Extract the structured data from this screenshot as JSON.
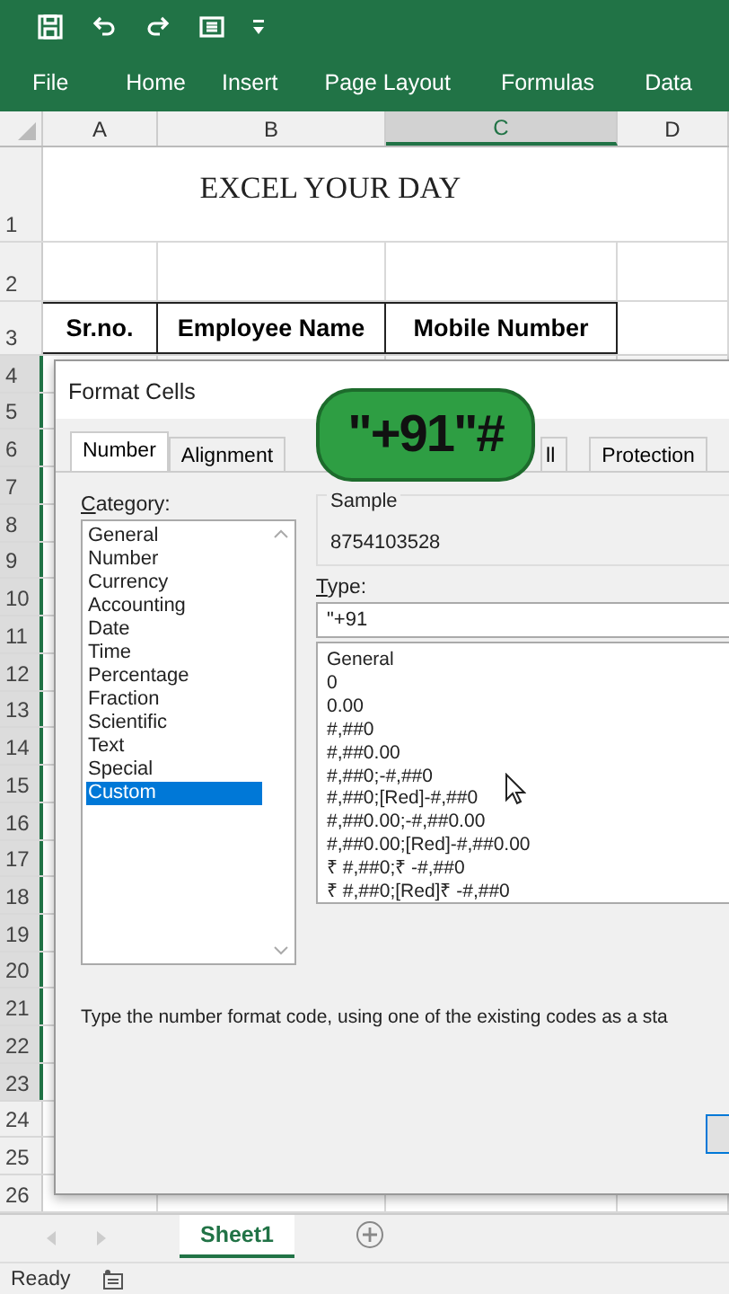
{
  "ribbon": {
    "tabs": [
      "File",
      "Home",
      "Insert",
      "Page Layout",
      "Formulas",
      "Data"
    ]
  },
  "sheet": {
    "columns": [
      {
        "label": "A",
        "selected": false
      },
      {
        "label": "B",
        "selected": false
      },
      {
        "label": "C",
        "selected": true
      },
      {
        "label": "D",
        "selected": false
      }
    ],
    "title": "EXCEL YOUR DAY",
    "header_row": [
      "Sr.no.",
      "Employee Name",
      "Mobile Number"
    ],
    "rows": [
      {
        "label": "1",
        "selected": false
      },
      {
        "label": "2",
        "selected": false
      },
      {
        "label": "3",
        "selected": false
      },
      {
        "label": "4",
        "selected": true
      },
      {
        "label": "5",
        "selected": true
      },
      {
        "label": "6",
        "selected": true
      },
      {
        "label": "7",
        "selected": true
      },
      {
        "label": "8",
        "selected": true
      },
      {
        "label": "9",
        "selected": true
      },
      {
        "label": "10",
        "selected": true
      },
      {
        "label": "11",
        "selected": true
      },
      {
        "label": "12",
        "selected": true
      },
      {
        "label": "13",
        "selected": true
      },
      {
        "label": "14",
        "selected": true
      },
      {
        "label": "15",
        "selected": true
      },
      {
        "label": "16",
        "selected": true
      },
      {
        "label": "17",
        "selected": true
      },
      {
        "label": "18",
        "selected": true
      },
      {
        "label": "19",
        "selected": true
      },
      {
        "label": "20",
        "selected": true
      },
      {
        "label": "21",
        "selected": true
      },
      {
        "label": "22",
        "selected": true
      },
      {
        "label": "23",
        "selected": true
      },
      {
        "label": "24",
        "selected": false
      },
      {
        "label": "25",
        "selected": false
      },
      {
        "label": "26",
        "selected": false
      }
    ]
  },
  "dialog": {
    "title": "Format Cells",
    "tabs": [
      {
        "label": "Number",
        "selected": true
      },
      {
        "label": "Alignment",
        "selected": false
      },
      {
        "label": "ll",
        "selected": false
      },
      {
        "label": "Protection",
        "selected": false
      }
    ],
    "category_label": "Category:",
    "categories": [
      {
        "label": "General",
        "selected": false
      },
      {
        "label": "Number",
        "selected": false
      },
      {
        "label": "Currency",
        "selected": false
      },
      {
        "label": "Accounting",
        "selected": false
      },
      {
        "label": "Date",
        "selected": false
      },
      {
        "label": "Time",
        "selected": false
      },
      {
        "label": "Percentage",
        "selected": false
      },
      {
        "label": "Fraction",
        "selected": false
      },
      {
        "label": "Scientific",
        "selected": false
      },
      {
        "label": "Text",
        "selected": false
      },
      {
        "label": "Special",
        "selected": false
      },
      {
        "label": "Custom",
        "selected": true
      }
    ],
    "sample_label": "Sample",
    "sample_value": "8754103528",
    "type_label": "Type:",
    "type_value": "\"+91",
    "formats": [
      "General",
      "0",
      "0.00",
      "#,##0",
      "#,##0.00",
      "#,##0;-#,##0",
      "#,##0;[Red]-#,##0",
      "#,##0.00;-#,##0.00",
      "#,##0.00;[Red]-#,##0.00",
      "₹ #,##0;₹ -#,##0",
      "₹ #,##0;[Red]₹ -#,##0"
    ],
    "description": "Type the number format code, using one of the existing codes as a sta"
  },
  "badge": {
    "text": "\"+91\"#"
  },
  "sheet_tabs": [
    {
      "label": "Sheet1",
      "selected": true
    }
  ],
  "status_bar": {
    "text": "Ready"
  }
}
